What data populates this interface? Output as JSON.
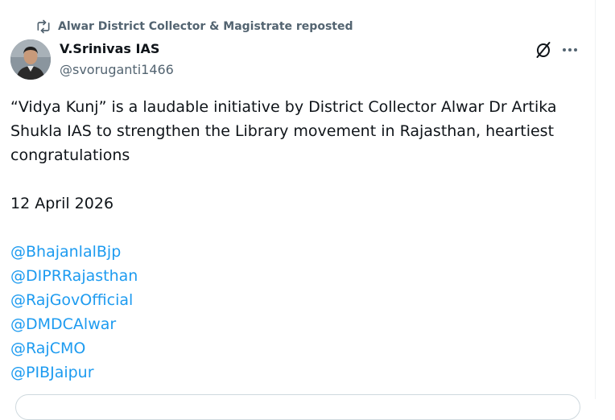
{
  "repost": {
    "icon": "repost-icon",
    "text": "Alwar District Collector & Magistrate reposted"
  },
  "author": {
    "display_name": "V.Srinivas IAS",
    "handle": "@svoruganti1466",
    "avatar": "avatar-photo"
  },
  "actions": {
    "grok_icon": "grok-icon",
    "more_icon": "more-icon"
  },
  "tweet": {
    "text": "“Vidya Kunj” is a laudable initiative by District Collector Alwar Dr Artika Shukla IAS to strengthen the Library movement in Rajasthan, heartiest congratulations",
    "date": "12 April 2026",
    "mentions": [
      "@BhajanlalBjp",
      "@DIPRRajasthan",
      "@RajGovOfficial",
      "@DMDCAlwar",
      "@RajCMO",
      "@PIBJaipur"
    ]
  },
  "colors": {
    "text": "#0f1419",
    "secondary": "#536471",
    "link": "#1d9bf0",
    "border": "#eff3f4"
  }
}
